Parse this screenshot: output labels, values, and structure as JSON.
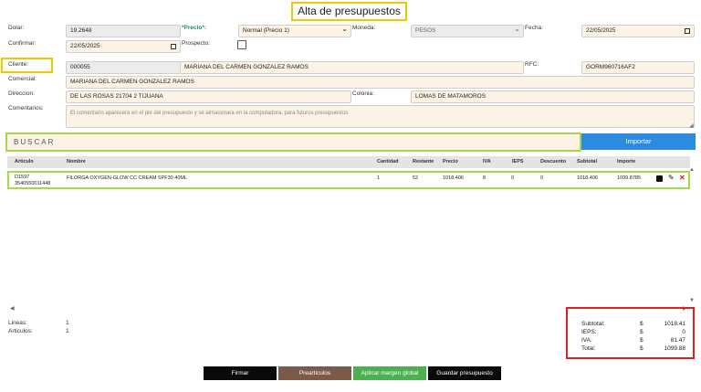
{
  "title": "Alta de presupuestos",
  "form": {
    "dolar_label": "Dolar:",
    "dolar_value": "19.2648",
    "precio_label": "*Precio*:",
    "precio_value": "Normal (Precio 1)",
    "moneda_label": "Moneda:",
    "moneda_value": "PESOS",
    "fecha_label": "Fecha:",
    "fecha_value": "22/05/2025",
    "confirmar_label": "Confirmar:",
    "confirmar_value": "22/05/2025",
    "prospecto_label": "Prospecto:",
    "cliente_label": "Cliente:",
    "cliente_code": "000055",
    "cliente_name": "MARIANA DEL CARMEN GONZALEZ RAMOS",
    "rfc_label": "RFC:",
    "rfc_value": "GORM960716AF2",
    "comercial_label": "Comercial:",
    "comercial_value": "MARIANA DEL CARMEN GONZALEZ RAMOS",
    "direccion_label": "Direccion:",
    "direccion_value": "DE LAS ROSAS 21704 2 TIJUANA",
    "colonia_label": "Colonia:",
    "colonia_value": "LOMAS DE MATAMOROS",
    "comentarios_label": "Comentarios:",
    "comentarios_placeholder": "El comentario aparecera en el pie del presupuesto y se almacenara en la computadora, para futuros presupuestos."
  },
  "search": {
    "placeholder": "BUSCAR",
    "import_label": "Importar"
  },
  "table": {
    "headers": [
      "Articulo",
      "Nombre",
      "Cantidad",
      "Restante",
      "Precio",
      "IVA",
      "IEPS",
      "Descuento",
      "Subtotal",
      "Importe"
    ],
    "rows": [
      {
        "articulo": "D1597",
        "barcode": "3540550011448",
        "nombre": "FILORGA OXYGEN-GLOW CC CREAM SPF30 40ML",
        "cantidad": "1",
        "restante": "52",
        "precio": "1018.406",
        "iva": "8",
        "ieps": "0",
        "descuento": "0",
        "subtotal": "1018.406",
        "importe": "1099.8785"
      }
    ]
  },
  "summary": {
    "lineas_label": "Lineas:",
    "lineas_value": "1",
    "articulos_label": "Articulos:",
    "articulos_value": "1"
  },
  "totals": {
    "currency": "$",
    "subtotal_label": "Subtotal:",
    "subtotal_value": "1018.41",
    "ieps_label": "IEPS:",
    "ieps_value": "0",
    "iva_label": "IVA:",
    "iva_value": "81.47",
    "total_label": "Total:",
    "total_value": "1099.88"
  },
  "buttons": {
    "firmar": "Firmar",
    "prearticulos": "Prearticulos",
    "aplicar_margen": "Aplicar margen global",
    "guardar": "Guardar presupuesto"
  },
  "colors": {
    "highlight_yellow": "#f0c800",
    "highlight_green": "#a6d84a",
    "highlight_red": "#e02020",
    "import_blue": "#2a8be0",
    "btn_black": "#0a0a0a",
    "btn_brown": "#7b5a4a",
    "btn_green": "#4caf50"
  }
}
